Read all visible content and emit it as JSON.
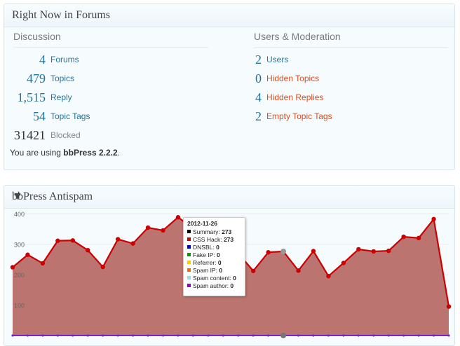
{
  "forums_widget": {
    "title": "Right Now in Forums",
    "discussion": {
      "title": "Discussion",
      "rows": [
        {
          "count": "4",
          "label": "Forums"
        },
        {
          "count": "479",
          "label": "Topics"
        },
        {
          "count": "1,515",
          "label": "Reply"
        },
        {
          "count": "54",
          "label": "Topic Tags"
        },
        {
          "count": "31421",
          "label": "Blocked"
        }
      ]
    },
    "moderation": {
      "title": "Users & Moderation",
      "rows": [
        {
          "count": "2",
          "label": "Users"
        },
        {
          "count": "0",
          "label": "Hidden Topics"
        },
        {
          "count": "4",
          "label": "Hidden Replies"
        },
        {
          "count": "2",
          "label": "Empty Topic Tags"
        }
      ]
    },
    "version_prefix": "You are using ",
    "version_name": "bbPress 2.2.2",
    "version_suffix": "."
  },
  "antispam_widget": {
    "title": "bbPress Antispam",
    "toggle_icon": "triangle-down-icon",
    "tooltip": {
      "date": "2012-11-26",
      "rows": [
        {
          "label": "Summary:",
          "value": "273",
          "color": "#000000"
        },
        {
          "label": "CSS Hack:",
          "value": "273",
          "color": "#cc0000"
        },
        {
          "label": "DNSBL:",
          "value": "0",
          "color": "#0000cc"
        },
        {
          "label": "Fake IP:",
          "value": "0",
          "color": "#009900"
        },
        {
          "label": "Referrer:",
          "value": "0",
          "color": "#ffcc00"
        },
        {
          "label": "Spam IP:",
          "value": "0",
          "color": "#ff6600"
        },
        {
          "label": "Spam content:",
          "value": "0",
          "color": "#99dddd"
        },
        {
          "label": "Spam author:",
          "value": "0",
          "color": "#9900cc"
        }
      ]
    }
  },
  "colors": {
    "link": "#21759b",
    "warning": "#d54e21",
    "series_line": "#cc0000",
    "series_fill": "#b5655f",
    "baseline": "#7b22c8"
  },
  "chart_data": {
    "type": "area",
    "title": "",
    "xlabel": "",
    "ylabel": "",
    "ylim": [
      0,
      400
    ],
    "yticks": [
      100,
      200,
      300,
      400
    ],
    "grid": true,
    "series": [
      {
        "name": "CSS Hack",
        "values": [
          224,
          265,
          237,
          311,
          312,
          280,
          225,
          316,
          302,
          354,
          345,
          388,
          351,
          320,
          273,
          270,
          212,
          273,
          276,
          213,
          277,
          195,
          238,
          283,
          276,
          278,
          324,
          320,
          382,
          95
        ]
      },
      {
        "name": "Spam author",
        "values": [
          0,
          0,
          0,
          0,
          0,
          0,
          0,
          0,
          0,
          0,
          0,
          0,
          0,
          0,
          0,
          0,
          0,
          0,
          0,
          0,
          0,
          0,
          0,
          0,
          0,
          0,
          0,
          0,
          0,
          0
        ]
      }
    ]
  }
}
